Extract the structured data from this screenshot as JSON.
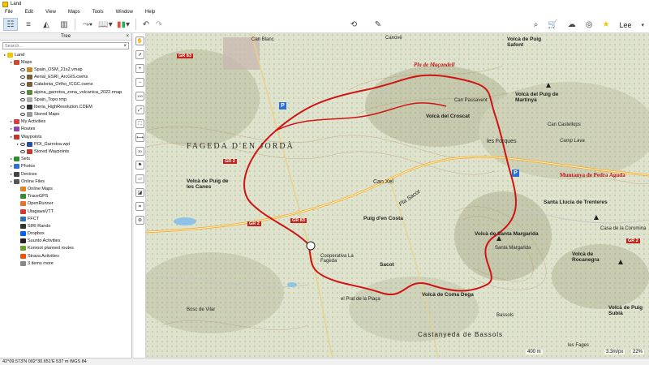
{
  "window": {
    "title": "Land"
  },
  "menu": [
    "File",
    "Edit",
    "View",
    "Maps",
    "Tools",
    "Window",
    "Help"
  ],
  "toolbar": {
    "user": "Lee",
    "star_color": "#f1c40f"
  },
  "tree": {
    "title": "Tree",
    "search_placeholder": "Search...",
    "items": [
      {
        "label": "Land",
        "indent": 0,
        "icon": "land-icon",
        "color": "#f5c400"
      },
      {
        "label": "Maps",
        "indent": 1,
        "icon": "maps-folder-icon",
        "color": "#d24a2c"
      },
      {
        "label": "Spain_OSM_21s2.vmap",
        "indent": 2,
        "icon": "map-file-icon",
        "color": "#c58a2e"
      },
      {
        "label": "Aerial_ESRI_ArcGIS.cwms",
        "indent": 2,
        "icon": "map-file-icon",
        "color": "#7a5d3a"
      },
      {
        "label": "Catalonia_Ortho_ICGC.cwms",
        "indent": 2,
        "icon": "map-file-icon",
        "color": "#7a5d3a"
      },
      {
        "label": "alpina_garrotxa_zona_volcanica_2022.rmap",
        "indent": 2,
        "icon": "map-file-icon",
        "color": "#5a8a3a"
      },
      {
        "label": "Spain_Topo.rmp",
        "indent": 2,
        "icon": "map-file-icon",
        "color": "#a9a9a9"
      },
      {
        "label": "Iberia_HighResolution.CDEM",
        "indent": 2,
        "icon": "dem-icon",
        "color": "#303030"
      },
      {
        "label": "Stored Maps",
        "indent": 2,
        "icon": "stored-maps-icon",
        "color": "#999999"
      },
      {
        "label": "My Activities",
        "indent": 1,
        "icon": "activities-icon",
        "color": "#e03b3b"
      },
      {
        "label": "Routes",
        "indent": 1,
        "icon": "routes-icon",
        "color": "#8e44ad"
      },
      {
        "label": "Waypoints",
        "indent": 1,
        "icon": "waypoints-icon",
        "color": "#c0392b"
      },
      {
        "label": "POI_Garrotxa.wpt",
        "indent": 2,
        "icon": "waypoint-file-icon",
        "color": "#1f4fa8"
      },
      {
        "label": "Stored Waypoints",
        "indent": 2,
        "icon": "stored-waypoints-icon",
        "color": "#c0392b"
      },
      {
        "label": "Sets",
        "indent": 1,
        "icon": "sets-icon",
        "color": "#2f8f2f"
      },
      {
        "label": "Photos",
        "indent": 1,
        "icon": "photos-icon",
        "color": "#2a6fd6"
      },
      {
        "label": "Devices",
        "indent": 1,
        "icon": "devices-icon",
        "color": "#444444"
      },
      {
        "label": "Online Files",
        "indent": 1,
        "icon": "online-files-icon",
        "color": "#555555"
      },
      {
        "label": "Online Maps",
        "indent": 2,
        "icon": "online-maps-icon",
        "color": "#e67e22"
      },
      {
        "label": "TraceGPS",
        "indent": 2,
        "icon": "tracegps-icon",
        "color": "#2f8f2f"
      },
      {
        "label": "OpenRunner",
        "indent": 2,
        "icon": "openrunner-icon",
        "color": "#e6722c"
      },
      {
        "label": "UtagawaVTT",
        "indent": 2,
        "icon": "utagawa-icon",
        "color": "#d33a2a"
      },
      {
        "label": "FFCT",
        "indent": 2,
        "icon": "ffct-icon",
        "color": "#2c6fbf"
      },
      {
        "label": "SIRI Rando",
        "indent": 2,
        "icon": "siri-rando-icon",
        "color": "#333333"
      },
      {
        "label": "Dropbox",
        "indent": 2,
        "icon": "dropbox-icon",
        "color": "#0061fe"
      },
      {
        "label": "Suunto Activities",
        "indent": 2,
        "icon": "suunto-icon",
        "color": "#222222"
      },
      {
        "label": "Komoot planned routes",
        "indent": 2,
        "icon": "komoot-icon",
        "color": "#6aa127"
      },
      {
        "label": "Strava Activities",
        "indent": 2,
        "icon": "strava-icon",
        "color": "#fc4c02"
      },
      {
        "label": "3 items more",
        "indent": 2,
        "icon": "more-icon",
        "color": "#888888"
      }
    ]
  },
  "map": {
    "labels": [
      {
        "text": "Can Blanc"
      },
      {
        "text": "Canové"
      },
      {
        "text": "Pla de Maçandell"
      },
      {
        "text": "Volcà de Puig Safont"
      },
      {
        "text": "Can Passavent"
      },
      {
        "text": "Volcà del Puig de Martinyà"
      },
      {
        "text": "FAGEDA D'EN JORDÀ"
      },
      {
        "text": "Volcà del Croscat"
      },
      {
        "text": "les Forques"
      },
      {
        "text": "Muntanya de Pedra Aguda"
      },
      {
        "text": "Can Xel"
      },
      {
        "text": "Puig d'en Costa"
      },
      {
        "text": "Pla Sacot"
      },
      {
        "text": "Santa Llucia de Trenteres"
      },
      {
        "text": "Volcà de Santa Margarida"
      },
      {
        "text": "Santa Margarida"
      },
      {
        "text": "Volcà de Puig de les Canes"
      },
      {
        "text": "Volcà de Rocanegra"
      },
      {
        "text": "Cooperativa La Fageda"
      },
      {
        "text": "Sacot"
      },
      {
        "text": "el Prat de la Plaça"
      },
      {
        "text": "Volcà de Puig Subià"
      },
      {
        "text": "Bosc de Vilar"
      },
      {
        "text": "Castanyeda de Bassols"
      },
      {
        "text": "Camp Lava"
      },
      {
        "text": "Can Castellops"
      },
      {
        "text": "Casa de la Coromina"
      },
      {
        "text": "les Fages"
      },
      {
        "text": "Bassols"
      },
      {
        "text": "Volcà de Coma Dega"
      }
    ],
    "roads": [
      "GR 83",
      "GR 2",
      "GR 2",
      "GR 83",
      "GR 2"
    ],
    "parking": [
      "P",
      "P"
    ],
    "scale_text": "400 m",
    "zoom_text": "3.3m/px",
    "zoom_pct": "22%",
    "route_color": "#d01414"
  },
  "status": {
    "text": "42°09.573'N 002°30.651'E  537 m  WGS 84"
  }
}
